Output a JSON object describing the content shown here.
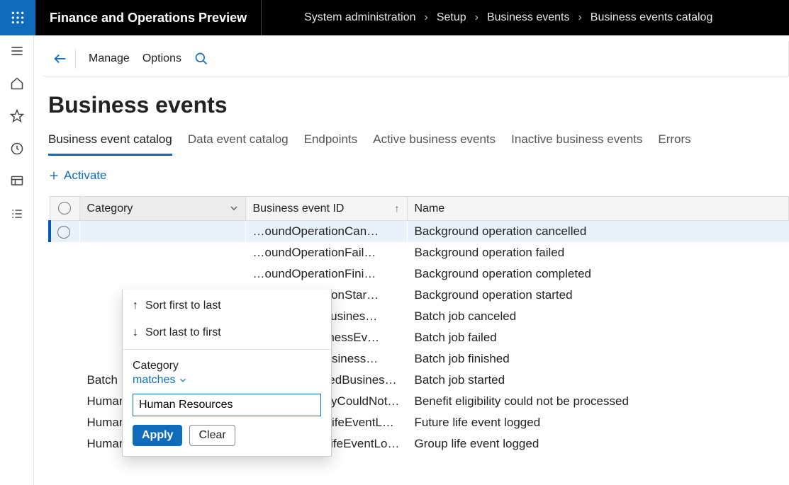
{
  "header": {
    "app_title": "Finance and Operations Preview",
    "breadcrumb": [
      "System administration",
      "Setup",
      "Business events",
      "Business events catalog"
    ]
  },
  "actionbar": {
    "manage": "Manage",
    "options": "Options"
  },
  "page": {
    "title": "Business events",
    "tabs": [
      "Business event catalog",
      "Data event catalog",
      "Endpoints",
      "Active business events",
      "Inactive business events",
      "Errors"
    ],
    "activate": "Activate"
  },
  "grid": {
    "columns": {
      "category": "Category",
      "event_id": "Business event ID",
      "name": "Name"
    },
    "rows": [
      {
        "category": "",
        "event_id": "…oundOperationCan…",
        "name": "Background operation cancelled"
      },
      {
        "category": "",
        "event_id": "…oundOperationFail…",
        "name": "Background operation failed"
      },
      {
        "category": "",
        "event_id": "…oundOperationFini…",
        "name": "Background operation completed"
      },
      {
        "category": "",
        "event_id": "…oundOperationStar…",
        "name": "Background operation started"
      },
      {
        "category": "",
        "event_id": "…bCanceledBusines…",
        "name": "Batch job canceled"
      },
      {
        "category": "",
        "event_id": "…bFailedBusinessEv…",
        "name": "Batch job failed"
      },
      {
        "category": "",
        "event_id": "…bFinishedBusiness…",
        "name": "Batch job finished"
      },
      {
        "category": "Batch",
        "event_id": "BatchJobStartedBusinessE…",
        "name": "Batch job started"
      },
      {
        "category": "Human resources",
        "event_id": "BenefitEligibilityCouldNot…",
        "name": "Benefit eligibility could not be processed"
      },
      {
        "category": "Human resources",
        "event_id": "BenefitFutureLifeEventLog…",
        "name": "Future life event logged"
      },
      {
        "category": "Human resources",
        "event_id": "BenefitGroupLifeEventLog…",
        "name": "Group life event logged"
      }
    ]
  },
  "filter": {
    "sort_first": "Sort first to last",
    "sort_last": "Sort last to first",
    "label": "Category",
    "operator": "matches",
    "value": "Human Resources",
    "apply": "Apply",
    "clear": "Clear"
  }
}
